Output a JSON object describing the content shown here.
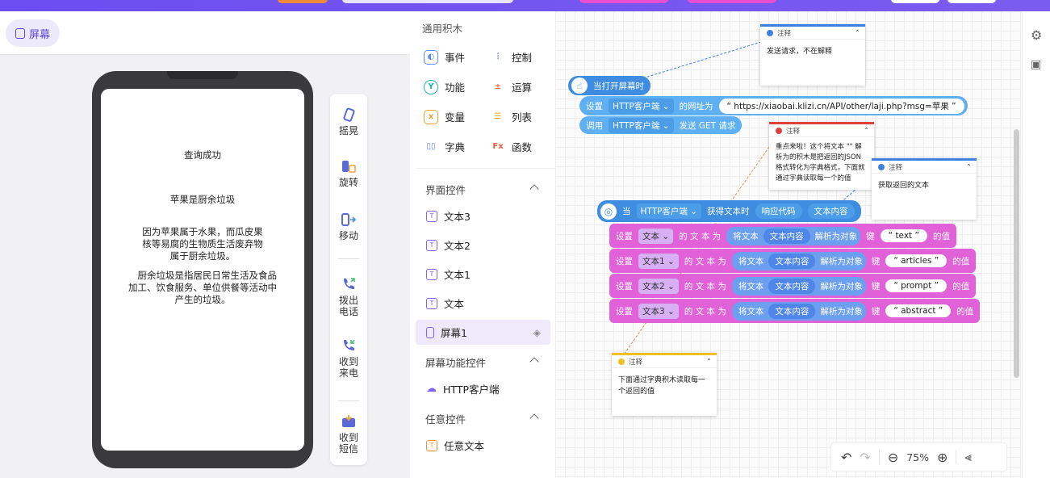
{
  "left": {
    "screen_tab": "屏幕",
    "display_lines": [
      "查询成功",
      "苹果是厨余垃圾",
      "因为苹果属于水果，而瓜皮果核等易腐的生物质生活废弃物属于厨余垃圾。",
      "厨余垃圾是指居民日常生活及食品加工、饮食服务、单位供餐等活动中产生的垃圾。"
    ],
    "tools": [
      "摇晃",
      "旋转",
      "移动",
      "拨出电话",
      "收到来电",
      "收到短信"
    ]
  },
  "palette": {
    "general_title": "通用积木",
    "general": [
      {
        "label": "事件",
        "color": "#5b8def"
      },
      {
        "label": "控制",
        "color": "#3f7fe0"
      },
      {
        "label": "功能",
        "color": "#1fb7a6"
      },
      {
        "label": "运算",
        "color": "#f06a3a"
      },
      {
        "label": "变量",
        "color": "#f0a030"
      },
      {
        "label": "列表",
        "color": "#f0b020"
      },
      {
        "label": "字典",
        "color": "#6a7cf0"
      },
      {
        "label": "函数",
        "color": "#f05a3a"
      }
    ],
    "ui_title": "界面控件",
    "ui_items": [
      "文本3",
      "文本2",
      "文本1",
      "文本",
      "屏幕1"
    ],
    "screen_title": "屏幕功能控件",
    "screen_items": [
      "HTTP客户端"
    ],
    "any_title": "任意控件",
    "any_items": [
      "任意文本"
    ]
  },
  "blocks": {
    "on_open": "当打开屏幕时",
    "set": "设置",
    "http_client": "HTTP客户端",
    "url_label": "的网址为",
    "url": "https://xiaobai.klizi.cn/API/other/laji.php?msg=苹果",
    "call": "调用",
    "send_get": "发送 GET 请求",
    "when": "当",
    "got_text": "获得文本时",
    "resp_code": "响应代码",
    "resp_text": "文本内容",
    "rows": [
      {
        "target": "文本",
        "key": "text"
      },
      {
        "target": "文本1",
        "key": "articles"
      },
      {
        "target": "文本2",
        "key": "prompt"
      },
      {
        "target": "文本3",
        "key": "abstract"
      }
    ],
    "text_of": "的 文 本 为",
    "convert": "将文本",
    "text_content": "文本内容",
    "parse_obj": "解析为对象",
    "key_label": "键",
    "value_label": "的值"
  },
  "notes": [
    {
      "title": "注释",
      "body": "发送请求，不在解释",
      "color": "#3f7fe0"
    },
    {
      "title": "注释",
      "body": "重点来啦！这个将文本 \"\" 解析为的积木是把返回的JSON格式转化为字典格式，下面就通过字典读取每一个的值",
      "color": "#e0403a"
    },
    {
      "title": "注释",
      "body": "获取返回的文本",
      "color": "#3f7fe0"
    },
    {
      "title": "注释",
      "body": "下面通过字典积木读取每一个返回的值",
      "color": "#f0c020"
    }
  ],
  "zoom": {
    "level": "75%"
  }
}
